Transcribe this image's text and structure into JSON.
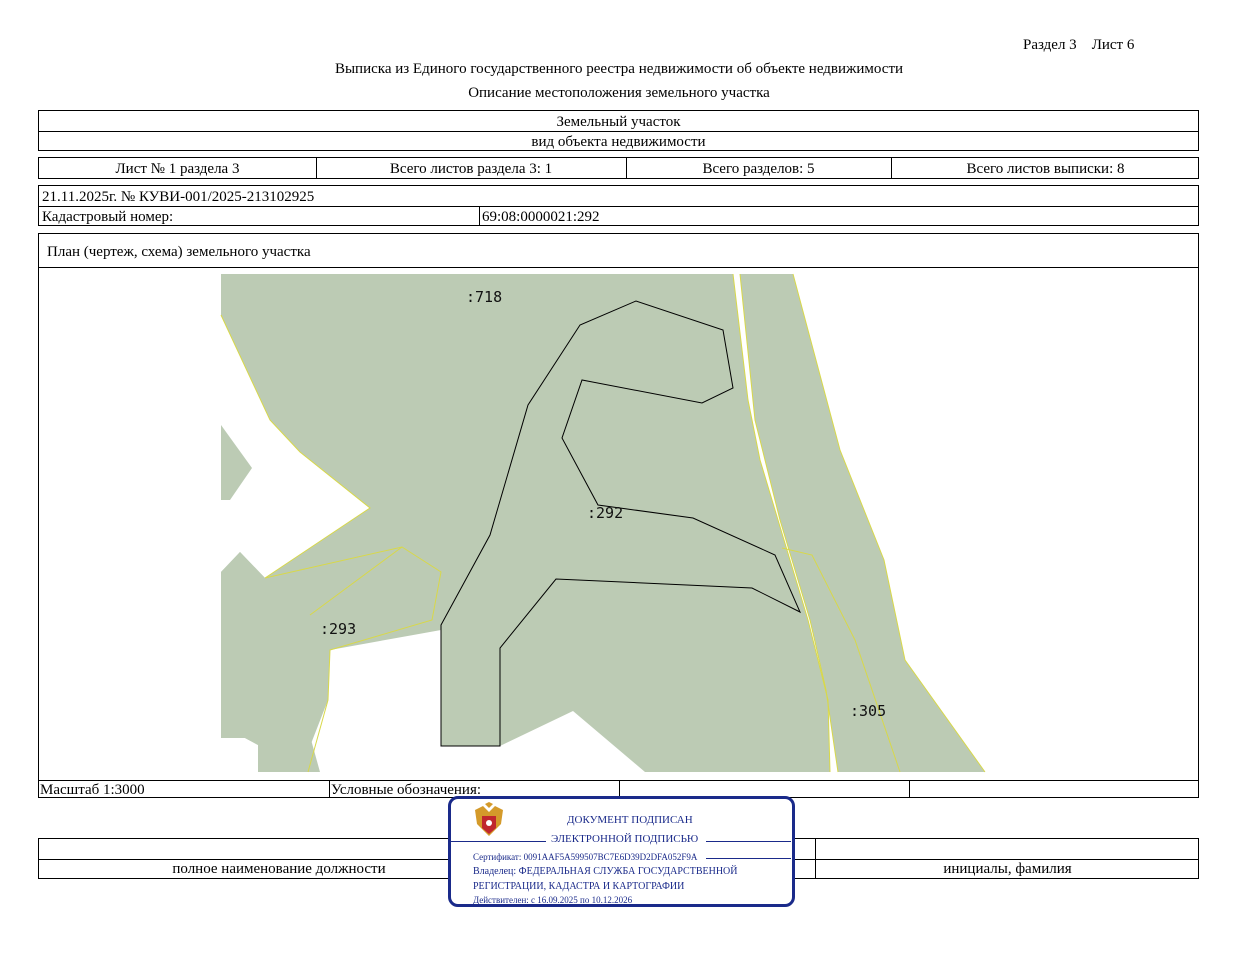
{
  "header": {
    "section": "Раздел 3",
    "sheet": "Лист 6",
    "title": "Выписка из Единого государственного реестра недвижимости об объекте недвижимости",
    "subtitle": "Описание местоположения земельного участка"
  },
  "object": {
    "type": "Земельный участок",
    "type_caption": "вид объекта недвижимости"
  },
  "sheets_row": {
    "sheet_of_section": "Лист № 1 раздела 3",
    "total_section_sheets": "Всего листов раздела 3: 1",
    "total_sections": "Всего разделов: 5",
    "total_extract_sheets": "Всего листов выписки: 8"
  },
  "meta": {
    "date_number": "21.11.2025г. № КУВИ-001/2025-213102925",
    "cadastral_label": "Кадастровый номер:",
    "cadastral_value": "69:08:0000021:292"
  },
  "plan": {
    "title": "План (чертеж, схема) земельного участка",
    "labels": {
      "p718": ":718",
      "p292": ":292",
      "p293": ":293",
      "p305": ":305"
    },
    "colors": {
      "parcel_fill": "#bccbb4",
      "neighbor_border": "#d8d84a",
      "main_border": "#000000"
    }
  },
  "footer": {
    "scale": "Масштаб 1:3000",
    "legend_label": "Условные обозначения:",
    "position_caption": "полное наименование должности",
    "name_caption": "инициалы, фамилия"
  },
  "stamp": {
    "line1": "ДОКУМЕНТ ПОДПИСАН",
    "line2": "ЭЛЕКТРОННОЙ ПОДПИСЬЮ",
    "certificate": "Сертификат: 0091AAF5A599507BC7E6D39D2DFA052F9A",
    "owner1": "Владелец: ФЕДЕРАЛЬНАЯ СЛУЖБА ГОСУДАРСТВЕННОЙ",
    "owner2": "РЕГИСТРАЦИИ, КАДАСТРА И КАРТОГРАФИИ",
    "valid": "Действителен: с 16.09.2025 по 10.12.2026",
    "emblem_icon": "coat-of-arms-icon"
  }
}
